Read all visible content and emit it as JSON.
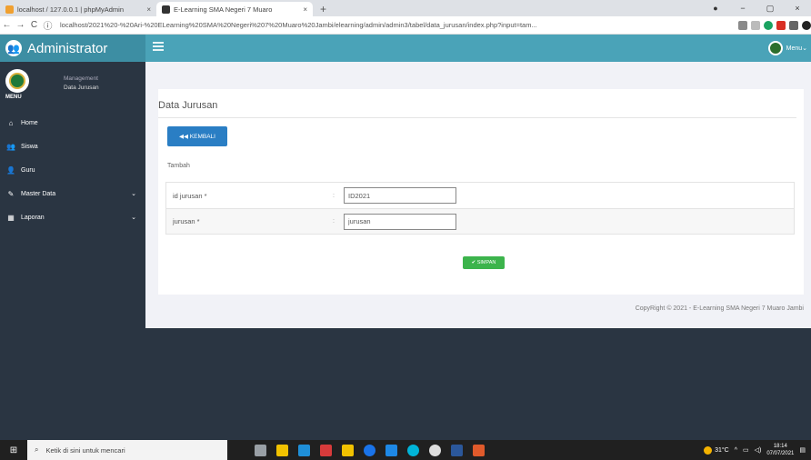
{
  "browser": {
    "tabs": [
      {
        "label": "localhost / 127.0.0.1 | phpMyAdmin",
        "icon_color": "#f0a030",
        "close": "×"
      },
      {
        "label": "E-Learning SMA Negeri 7 Muaro",
        "icon_color": "#333333",
        "close": "×"
      }
    ],
    "new_tab": "+",
    "window_controls": [
      "−",
      "▢",
      "×"
    ],
    "url": "localhost/2021%20-%20Ari-%20ELearning%20SMA%20Negeri%207%20Muaro%20Jambi/elearning/admin/admin3/tabel/data_jurusan/index.php?input=tam...",
    "nav": {
      "back": "←",
      "forward": "→",
      "reload": "C",
      "info": "ⓘ"
    }
  },
  "app": {
    "brand": "Administrator",
    "user_menu": "Menu"
  },
  "sidebar": {
    "role": "Management",
    "page": "Data Jurusan",
    "menu_label": "MENU",
    "items": [
      {
        "label": "Home",
        "icon": "home-icon",
        "glyph": "⌂"
      },
      {
        "label": "Siswa",
        "icon": "users-icon",
        "glyph": "👥"
      },
      {
        "label": "Guru",
        "icon": "user-icon",
        "glyph": "👤"
      },
      {
        "label": "Master Data",
        "icon": "edit-icon",
        "glyph": "✎",
        "chevron": "⌄"
      },
      {
        "label": "Laporan",
        "icon": "calendar-icon",
        "glyph": "▦",
        "chevron": "⌄"
      }
    ]
  },
  "main": {
    "title": "Data Jurusan",
    "back_button": "◀◀ KEMBALI",
    "tambah": "Tambah",
    "form": {
      "id_label": "id jurusan *",
      "id_value": "ID2021",
      "jurusan_label": "jurusan *",
      "jurusan_value": "jurusan",
      "colon": ":"
    },
    "save_button": "✔ SIMPAN",
    "footer": "CopyRight © 2021 - E-Learning SMA Negeri 7 Muaro Jambi"
  },
  "taskbar": {
    "search_placeholder": "Ketik di sini untuk mencari",
    "weather": "31°C",
    "time": "18:14",
    "date": "07/07/2021",
    "app_colors": [
      "#9aa0a6",
      "#f2c200",
      "#1f8fd8",
      "#d83b3b",
      "#f2c200",
      "#1a73e8",
      "#1e88e5",
      "#00b4d8",
      "#dddddd",
      "#2b579a",
      "#e05a2b"
    ]
  }
}
